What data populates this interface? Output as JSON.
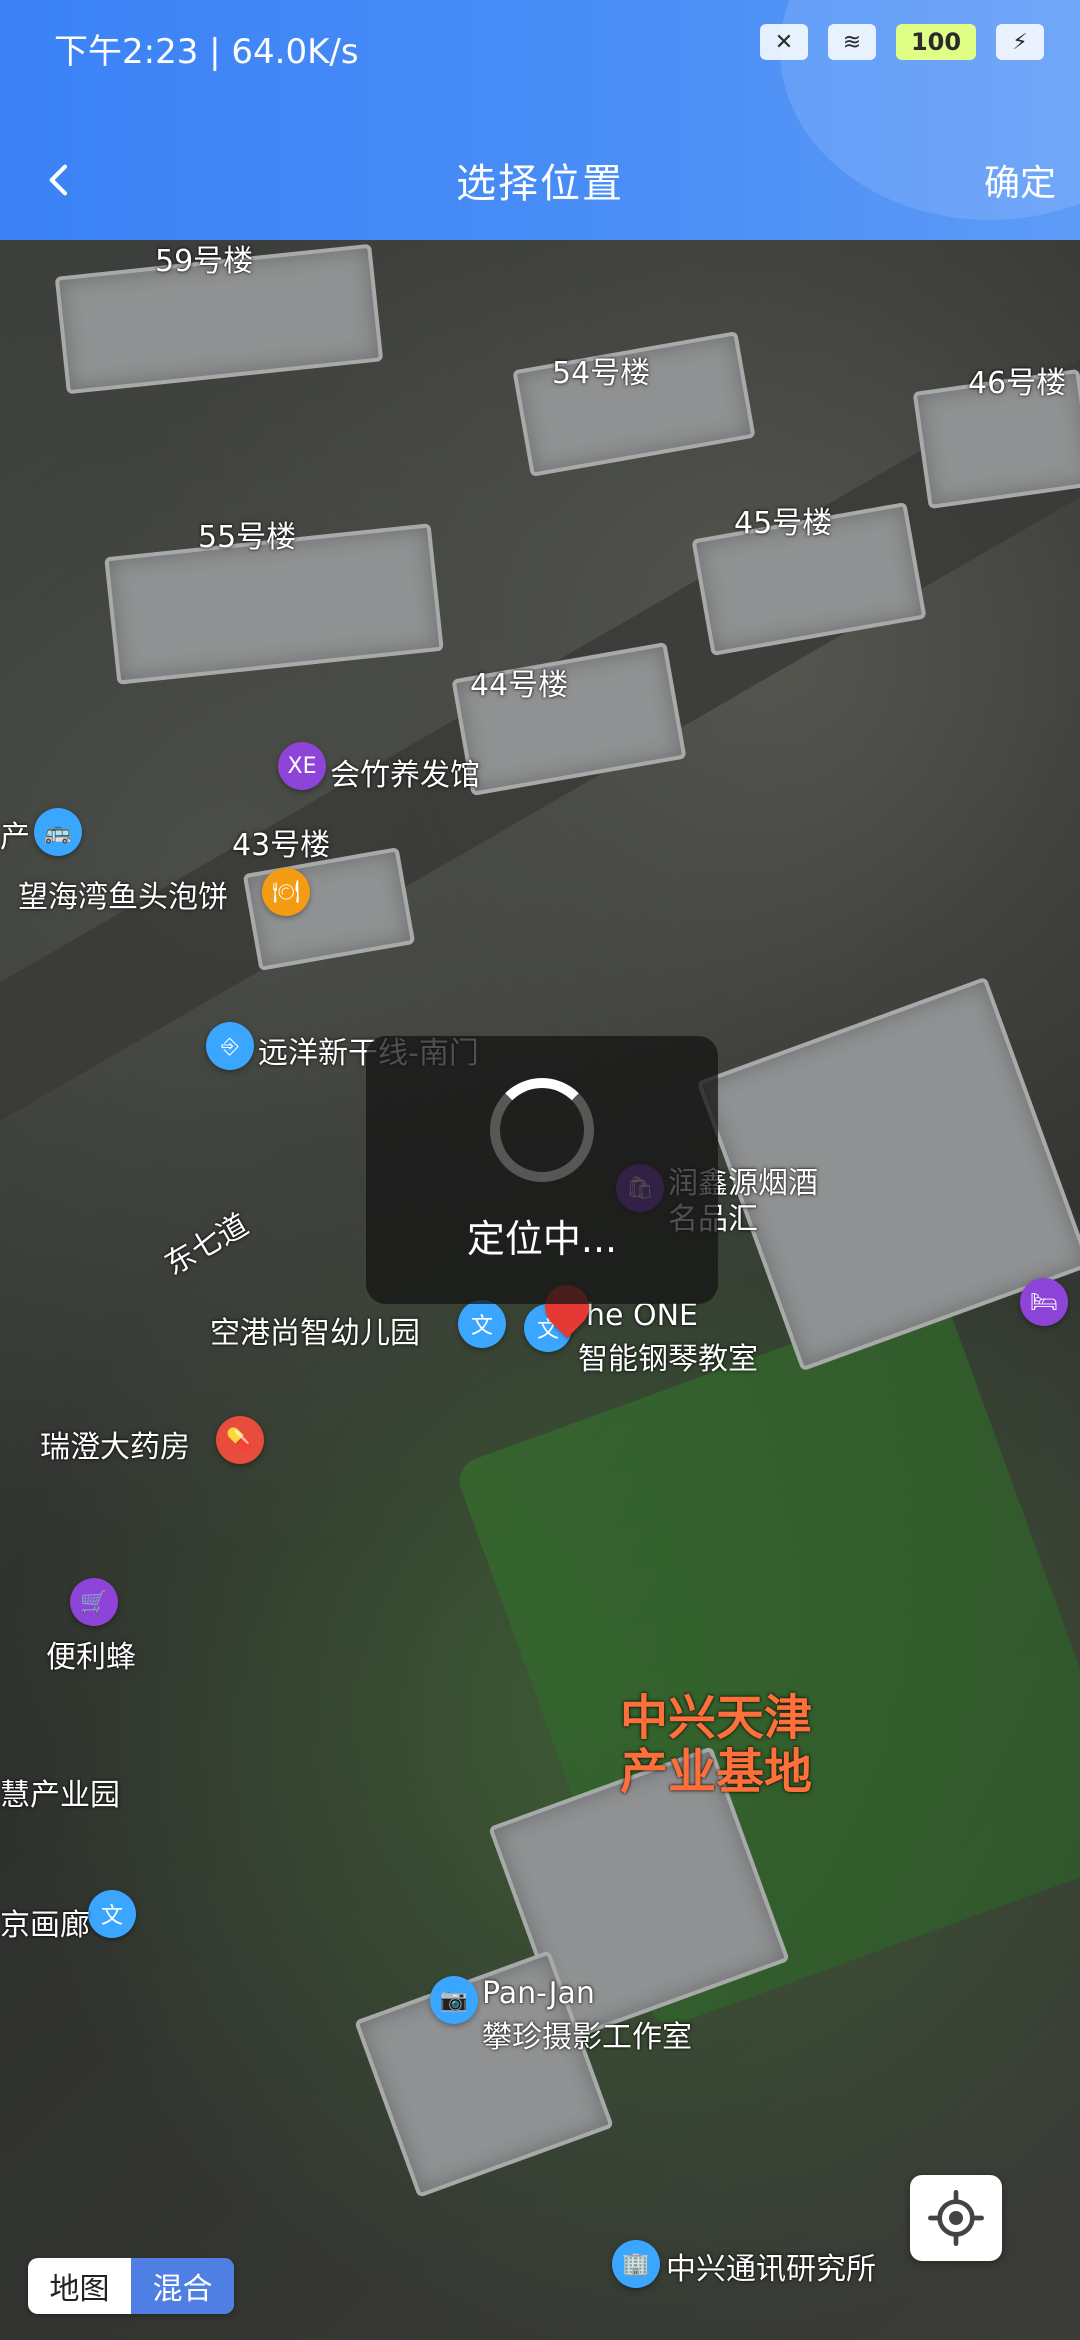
{
  "status_bar": {
    "time_speed": "下午2:23 | 64.0K/s",
    "battery": "100"
  },
  "header": {
    "title": "选择位置",
    "confirm": "确定"
  },
  "loading": {
    "text": "定位中..."
  },
  "map": {
    "labels": {
      "building_59": "59号楼",
      "building_54": "54号楼",
      "building_46": "46号楼",
      "building_55": "55号楼",
      "building_45": "45号楼",
      "building_44": "44号楼",
      "building_43": "43号楼",
      "huizhu": "会竹养发馆",
      "wanghaiwan": "望海湾鱼头泡饼",
      "yuanyang": "远洋新干线-南门",
      "runxinyuan_1": "润鑫源烟酒",
      "runxinyuan_2": "名品汇",
      "dongqi": "东七道",
      "kindergarten": "空港尚智幼儿园",
      "piano_1": "he ONE",
      "piano_2": "智能钢琴教室",
      "ruicheng": "瑞澄大药房",
      "bianlifeng": "便利蜂",
      "zhongxing_1": "中兴天津",
      "zhongxing_2": "产业基地",
      "chanyeyuan": "慧产业园",
      "hualang": "京画廊",
      "panjan_1": "Pan-Jan",
      "panjan_2": "攀珍摄影工作室",
      "zte_research": "中兴通讯研究所",
      "chan_left": "产"
    },
    "mode": {
      "map": "地图",
      "mixed": "混合"
    }
  }
}
